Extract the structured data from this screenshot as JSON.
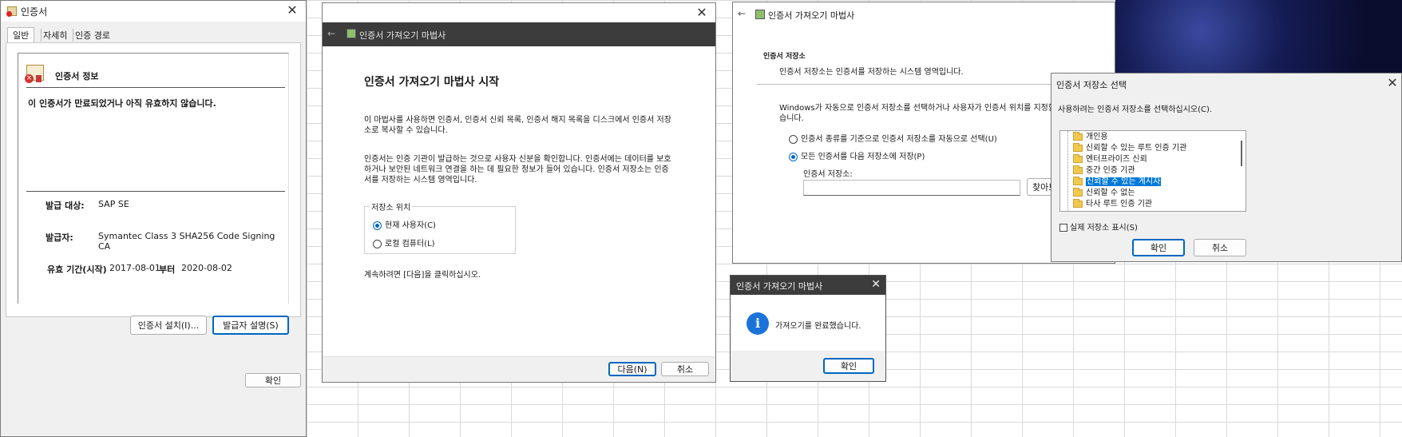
{
  "cert_window": {
    "title": "인증서",
    "tabs": [
      "일반",
      "자세히",
      "인증 경로"
    ],
    "section_title": "인증서 정보",
    "warning": "이 인증서가 만료되었거나 아직 유효하지 않습니다.",
    "issued_to_label": "발급 대상:",
    "issued_to_value": "SAP SE",
    "issued_by_label": "발급자:",
    "issued_by_value": "Symantec Class 3 SHA256 Code Signing CA",
    "valid_label": "유효 기간(시작)",
    "valid_from": "2017-08-01",
    "valid_to_word": "부터",
    "valid_to": "2020-08-02",
    "install_button": "인증서 설치(I)...",
    "issuer_statement_button": "발급자 설명(S)",
    "ok_button": "확인"
  },
  "wizard_start": {
    "title": "인증서 가져오기 마법사",
    "heading": "인증서 가져오기 마법사 시작",
    "para1_line1": "이 마법사를 사용하면 인증서, 인증서 신뢰 목록, 인증서 해지 목록을 디스크에서 인증서 저장",
    "para1_line2": "소로 복사할 수 있습니다.",
    "para2_line1": "인증서는 인증 기관이 발급하는 것으로 사용자 신분을 확인합니다. 인증서에는 데이터를 보호",
    "para2_line2": "하거나 보안된 네트워크 연결을 하는 데 필요한 정보가 들어 있습니다. 인증서 저장소는 인증",
    "para2_line3": "서를 저장하는 시스템 영역입니다.",
    "store_group_label": "저장소 위치",
    "option_current_user": "현재 사용자(C)",
    "option_local_machine": "로컬 컴퓨터(L)",
    "continue_text": "계속하려면 [다음]을 클릭하십시오.",
    "next_button": "다음(N)",
    "cancel_button": "취소"
  },
  "wizard_store": {
    "title": "인증서 가져오기 마법사",
    "section_title": "인증서 저장소",
    "section_desc": "인증서 저장소는 인증서를 저장하는 시스템 영역입니다.",
    "info_line1": "Windows가 자동으로 인증서 저장소를 선택하거나 사용자가 인증서 위치를 지정할",
    "info_line2": "습니다.",
    "option_auto": "인증서 종류를 기준으로 인증서 저장소를 자동으로 선택(U)",
    "option_manual": "모든 인증서를 다음 저장소에 저장(P)",
    "store_field_label": "인증서 저장소:",
    "browse_button": "찾아보"
  },
  "select_store": {
    "title": "인증서 저장소 선택",
    "instruction": "사용하려는 인증서 저장소를 선택하십시오(C).",
    "items": [
      "개인용",
      "신뢰할 수 있는 루트 인증 기관",
      "엔터프라이즈 신뢰",
      "중간 인증 기관",
      "신뢰할 수 있는 게시자",
      "신뢰할 수 없는",
      "타사 루트 인증 기관"
    ],
    "selected_item": "신뢰할 수 있는 게시자",
    "show_physical": "실제 저장소 표시(S)",
    "ok_button": "확인",
    "cancel_button": "취소"
  },
  "complete_dialog": {
    "title": "인증서 가져오기 마법사",
    "message": "가져오기를 완료했습니다.",
    "ok_button": "확인"
  },
  "colors": {
    "accent": "#0067c0",
    "wizard_header": "#3c3c3c",
    "selection": "#0078d7"
  }
}
